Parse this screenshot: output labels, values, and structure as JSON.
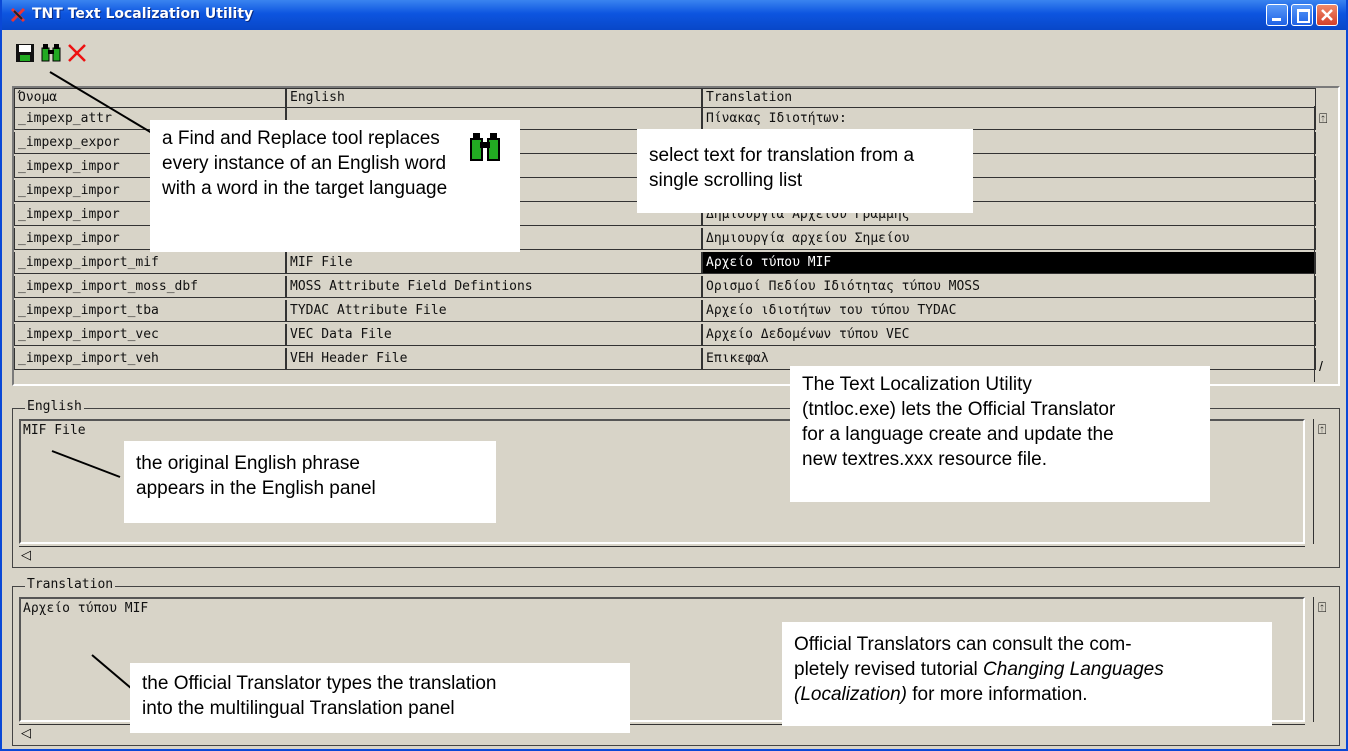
{
  "window": {
    "title": "TNT Text Localization Utility"
  },
  "toolbar": {
    "save": "save-icon",
    "find": "find-replace-icon",
    "close": "close-icon"
  },
  "table": {
    "headers": [
      "Όνομα",
      "English",
      "Translation"
    ],
    "rows": [
      {
        "name": "_impexp_attr",
        "english": "",
        "translation": "Πίνακας Ιδιοτήτων:"
      },
      {
        "name": "_impexp_expor",
        "english": "",
        "translation": ""
      },
      {
        "name": "_impexp_impor",
        "english": "",
        "translation": ""
      },
      {
        "name": "_impexp_impor",
        "english": "",
        "translation": ""
      },
      {
        "name": "_impexp_impor",
        "english": "",
        "translation": "Δημιουργία Αρχείου Γραμμής"
      },
      {
        "name": "_impexp_impor",
        "english": "",
        "translation": "Δημιουργία αρχείου Σημείου"
      },
      {
        "name": "_impexp_import_mif",
        "english": "MIF File",
        "translation": "Αρχείο τύπου MIF"
      },
      {
        "name": "_impexp_import_moss_dbf",
        "english": "MOSS Attribute Field Defintions",
        "translation": "Ορισμοί Πεδίου Ιδιότητας τύπου MOSS"
      },
      {
        "name": "_impexp_import_tba",
        "english": "TYDAC Attribute File",
        "translation": "Αρχείο ιδιοτήτων του τύπου TYDAC"
      },
      {
        "name": "_impexp_import_vec",
        "english": "VEC Data File",
        "translation": "Αρχείο Δεδομένων τύπου VEC"
      },
      {
        "name": "_impexp_import_veh",
        "english": "VEH Header File",
        "translation": "Επικεφαλ"
      }
    ]
  },
  "english_panel": {
    "label": "English",
    "text": "MIF File"
  },
  "translation_panel": {
    "label": "Translation",
    "text": "Αρχείο τύπου MIF"
  },
  "notes": {
    "find_replace": "a Find and Replace tool replaces every instance of an English word with a word in the target language",
    "select": "select text for translation from a single scrolling list",
    "utility_1": "The Text Localization Utility",
    "utility_2": "(tntloc.exe) lets the Official Translator",
    "utility_3": "for a language create and update the",
    "utility_4": "new textres.xxx resource file.",
    "english_1": "the original English phrase",
    "english_2": "appears in the English panel",
    "translator_1": "the Official Translator types the translation",
    "translator_2": "into the multilingual Translation panel",
    "tutorial_1": "Official Translators can consult the com-",
    "tutorial_2a": "pletely revised tutorial ",
    "tutorial_2b": "Changing Languages",
    "tutorial_3a": "(Localization)",
    "tutorial_3b": " for more information."
  }
}
